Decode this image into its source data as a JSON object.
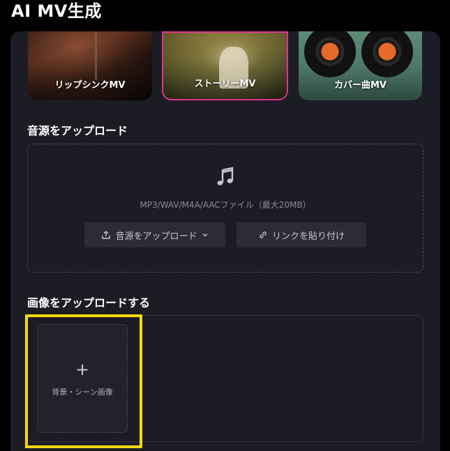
{
  "page": {
    "title": "AI MV生成"
  },
  "modes": [
    {
      "label": "リップシンクMV",
      "selected": false
    },
    {
      "label": "ストーリーMV",
      "selected": true
    },
    {
      "label": "カバー曲MV",
      "selected": false
    }
  ],
  "audio": {
    "section_title": "音源をアップロード",
    "icon": "music-note-icon",
    "hint": "MP3/WAV/M4A/AACファイル（最大20MB）",
    "upload_button_label": "音源をアップロード",
    "link_button_label": "リンクを貼り付け"
  },
  "image": {
    "section_title": "画像をアップロードする",
    "slot_plus": "+",
    "slot_label": "背景・シーン画像"
  },
  "colors": {
    "accent_selected": "#e8308f",
    "highlight": "#f5d90a",
    "panel": "#1c1c24"
  }
}
